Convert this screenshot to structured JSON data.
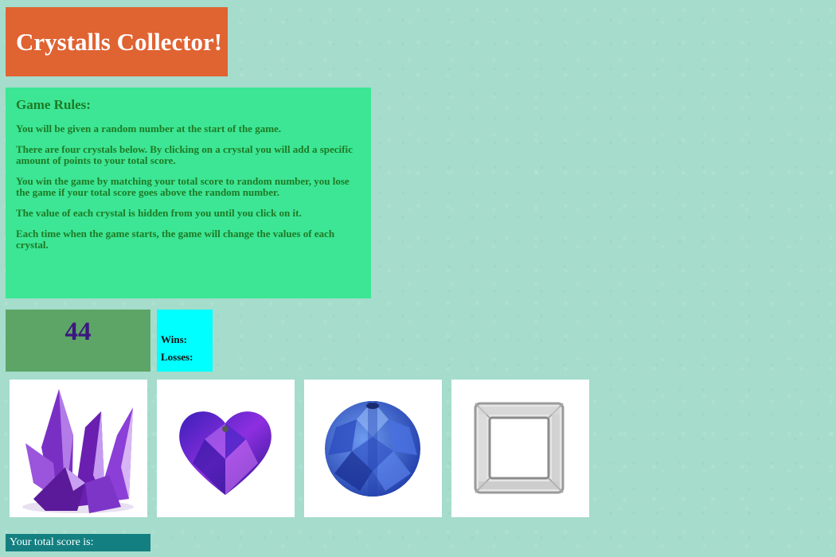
{
  "header": {
    "title": "Crystalls Collector!"
  },
  "rules": {
    "heading": "Game Rules:",
    "paragraphs": [
      "You will be given a random number at the start of the game.",
      "There are four crystals below. By clicking on a crystal you will add a specific amount of points to your total score.",
      "You win the game by matching your total score to random number, you lose the game if your total score goes above the random number.",
      "The value of each crystal is hidden from you until you click on it.",
      "Each time when the game starts, the game will change the values of each crystal."
    ]
  },
  "game": {
    "target_number": "44",
    "wins_label": "Wins:",
    "losses_label": "Losses:",
    "total_score_label": "Your total score is:"
  },
  "crystals": [
    {
      "icon": "purple-crystal-cluster-icon",
      "color": "#8a3fd1"
    },
    {
      "icon": "heart-crystal-icon",
      "color": "#6a2bd8"
    },
    {
      "icon": "blue-round-crystal-icon",
      "color": "#3a62d6"
    },
    {
      "icon": "clear-square-crystal-icon",
      "color": "#d8d8d8"
    }
  ],
  "colors": {
    "background": "#a5dccc",
    "title_bg": "#e06332",
    "rules_bg": "#3ce695",
    "rules_text": "#1f7a24",
    "target_bg": "#5da566",
    "target_text": "#3b1680",
    "stats_bg": "#00ffff",
    "score_bg": "#137f80"
  }
}
